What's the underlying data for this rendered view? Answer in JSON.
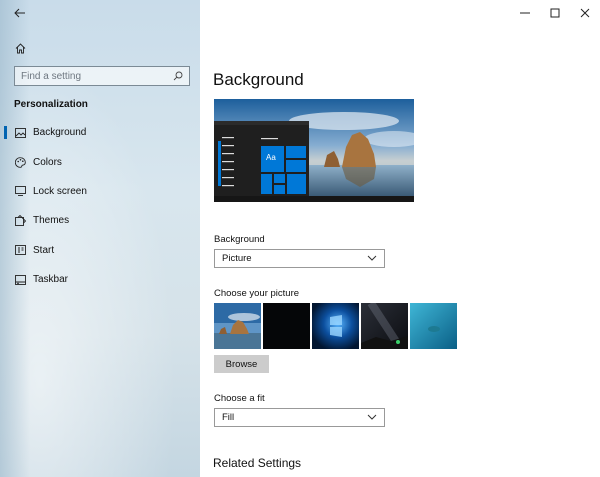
{
  "sidebar": {
    "back_icon": "back-arrow-icon",
    "home_icon": "home-icon",
    "search": {
      "placeholder": "Find a setting",
      "value": "",
      "icon": "search-icon"
    },
    "section_title": "Personalization",
    "items": [
      {
        "label": "Background",
        "icon": "picture-icon",
        "active": true
      },
      {
        "label": "Colors",
        "icon": "palette-icon",
        "active": false
      },
      {
        "label": "Lock screen",
        "icon": "lock-screen-icon",
        "active": false
      },
      {
        "label": "Themes",
        "icon": "themes-icon",
        "active": false
      },
      {
        "label": "Start",
        "icon": "start-icon",
        "active": false
      },
      {
        "label": "Taskbar",
        "icon": "taskbar-icon",
        "active": false
      }
    ]
  },
  "window_controls": [
    "minimize-icon",
    "maximize-icon",
    "close-icon"
  ],
  "main": {
    "title": "Background",
    "preview": {
      "tile_text": "Aa"
    },
    "background_field": {
      "label": "Background",
      "value": "Picture"
    },
    "choose_picture": {
      "label": "Choose your picture",
      "browse_label": "Browse"
    },
    "fit_field": {
      "label": "Choose a fit",
      "value": "Fill"
    },
    "related_settings": "Related Settings"
  },
  "colors": {
    "accent": "#0063b1",
    "tile_blue": "#0078d7",
    "browse_bg": "#cccccc"
  }
}
